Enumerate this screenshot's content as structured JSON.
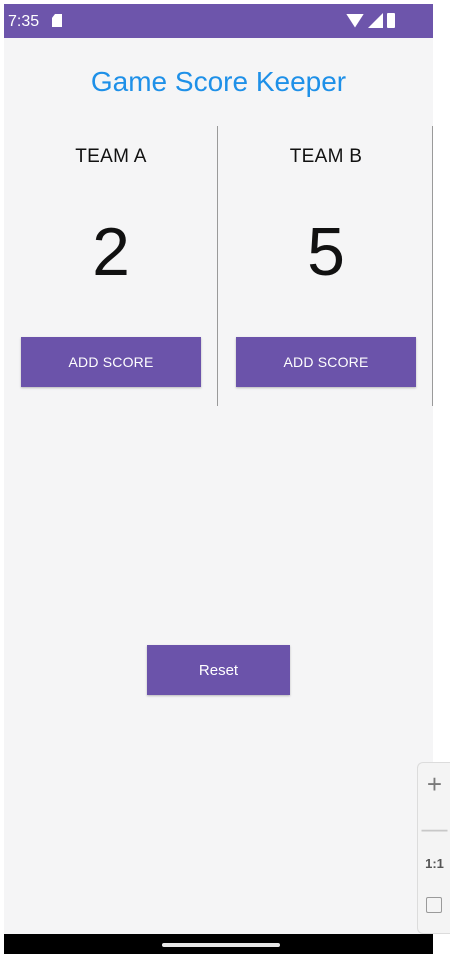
{
  "status_bar": {
    "time": "7:35",
    "bg_color": "#6d55ab"
  },
  "app": {
    "title": "Game Score Keeper",
    "title_color": "#1e90e8",
    "button_color": "#6b53aa"
  },
  "teams": [
    {
      "name": "TEAM A",
      "score": "2",
      "button_label": "ADD SCORE"
    },
    {
      "name": "TEAM B",
      "score": "5",
      "button_label": "ADD SCORE"
    }
  ],
  "reset_label": "Reset",
  "zoom_controls": {
    "zoom_in": "+",
    "zoom_out": "—",
    "actual_size": "1:1"
  }
}
